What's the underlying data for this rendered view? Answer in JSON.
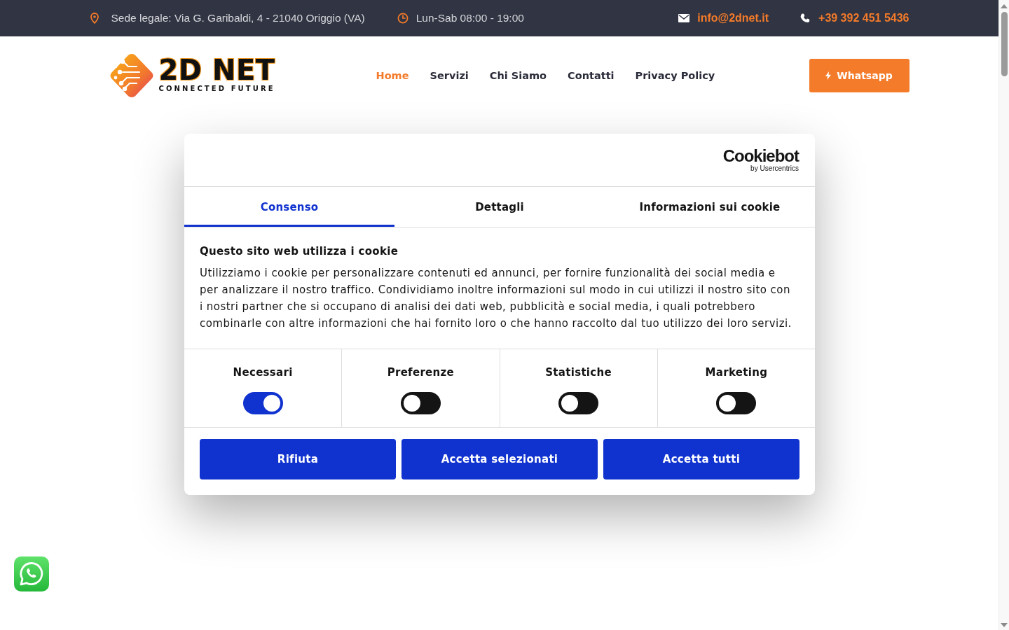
{
  "top_bar": {
    "address": "Sede legale: Via G. Garibaldi, 4 - 21040 Origgio (VA)",
    "hours": "Lun-Sab 08:00 - 19:00",
    "email": "info@2dnet.it",
    "phone": "+39 392 451 5436"
  },
  "header": {
    "logo": {
      "name": "2D NET",
      "tagline": "CONNECTED FUTURE"
    },
    "nav": [
      {
        "label": "Home",
        "selected": true
      },
      {
        "label": "Servizi",
        "selected": false
      },
      {
        "label": "Chi Siamo",
        "selected": false
      },
      {
        "label": "Contatti",
        "selected": false
      },
      {
        "label": "Privacy Policy",
        "selected": false
      }
    ],
    "cta_button": "Whatsapp"
  },
  "cookie_dialog": {
    "brand": "Cookiebot",
    "brand_byline": "by Usercentrics",
    "tabs": [
      {
        "label": "Consenso",
        "selected": true
      },
      {
        "label": "Dettagli",
        "selected": false
      },
      {
        "label": "Informazioni sui cookie",
        "selected": false
      }
    ],
    "title": "Questo sito web utilizza i cookie",
    "text": "Utilizziamo i cookie per personalizzare contenuti ed annunci, per fornire funzionalità dei social media e per analizzare il nostro traffico. Condividiamo inoltre informazioni sul modo in cui utilizzi il nostro sito con i nostri partner che si occupano di analisi dei dati web, pubblicità e social media, i quali potrebbero combinarle con altre informazioni che hai fornito loro o che hanno raccolto dal tuo utilizzo dei loro servizi.",
    "toggles": [
      {
        "label": "Necessari",
        "on": true
      },
      {
        "label": "Preferenze",
        "on": false
      },
      {
        "label": "Statistiche",
        "on": false
      },
      {
        "label": "Marketing",
        "on": false
      }
    ],
    "buttons": [
      "Rifiuta",
      "Accetta selezionati",
      "Accetta tutti"
    ]
  }
}
